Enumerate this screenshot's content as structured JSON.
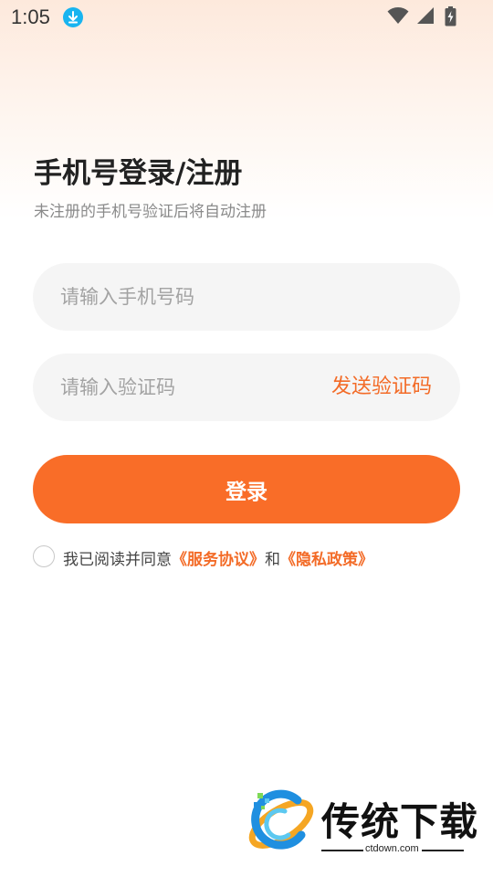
{
  "status_bar": {
    "time": "1:05",
    "icons": [
      "download-icon",
      "wifi-icon",
      "signal-icon",
      "battery-charging-icon"
    ]
  },
  "login": {
    "title": "手机号登录/注册",
    "subtitle": "未注册的手机号验证后将自动注册",
    "phone_placeholder": "请输入手机号码",
    "phone_value": "",
    "code_placeholder": "请输入验证码",
    "code_value": "",
    "send_code_label": "发送验证码",
    "login_button_label": "登录"
  },
  "agreement": {
    "prefix": "我已阅读并同意",
    "service_link": "《服务协议》",
    "conjunction": "和",
    "privacy_link": "《隐私政策》",
    "checked": false
  },
  "watermark": {
    "title": "传统下载",
    "url": "ctdown.com"
  },
  "colors": {
    "accent": "#f96d28",
    "link": "#f36b27",
    "field_bg": "#f5f5f5",
    "download_badge": "#18b4f0"
  }
}
